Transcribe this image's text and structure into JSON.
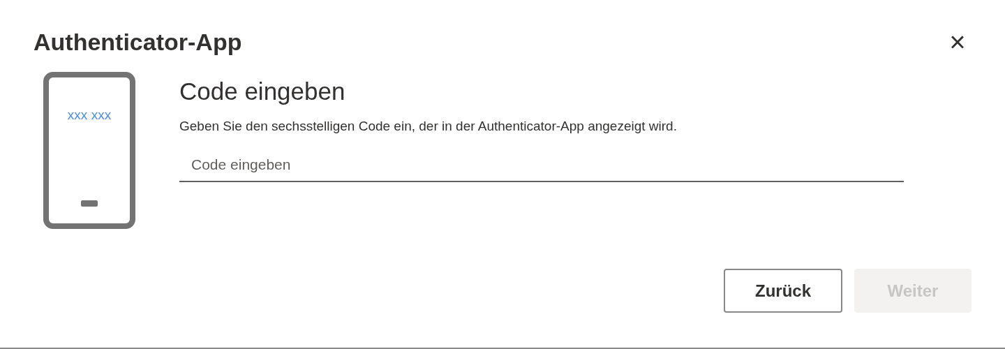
{
  "dialog": {
    "title": "Authenticator-App",
    "close": "×"
  },
  "illustration": {
    "code_text": "xxx xxx"
  },
  "heading": "Code eingeben",
  "description": "Geben Sie den sechsstelligen Code ein, der in der Authenticator-App angezeigt wird.",
  "code_field": {
    "placeholder": "Code eingeben"
  },
  "buttons": [
    {
      "label": "Zurück",
      "disabled": false
    },
    {
      "label": "Weiter",
      "disabled": true
    }
  ]
}
